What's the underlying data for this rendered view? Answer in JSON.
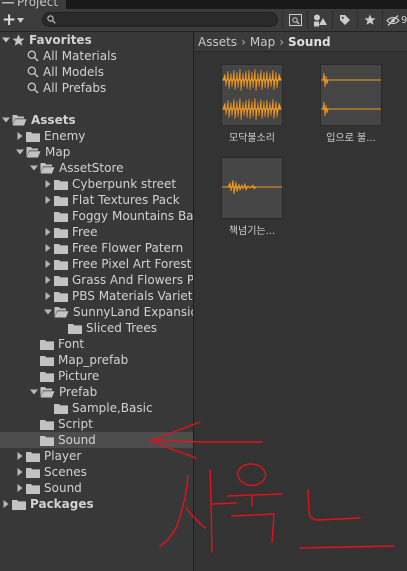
{
  "window": {
    "tab_title": "Project"
  },
  "toolbar": {
    "add_label": "+",
    "search_value": "",
    "hidden_count": "9"
  },
  "tree": {
    "favorites": {
      "label": "Favorites",
      "items": [
        {
          "label": "All Materials"
        },
        {
          "label": "All Models"
        },
        {
          "label": "All Prefabs"
        }
      ]
    },
    "rows": [
      {
        "label": "Assets",
        "bold": true,
        "expanded": true
      },
      {
        "label": "Enemy",
        "expanded": false
      },
      {
        "label": "Map",
        "expanded": true
      },
      {
        "label": "AssetStore",
        "expanded": true
      },
      {
        "label": "Cyberpunk street",
        "expanded": false
      },
      {
        "label": "Flat Textures Pack",
        "expanded": false
      },
      {
        "label": "Foggy Mountains Backgro"
      },
      {
        "label": "Free",
        "expanded": false
      },
      {
        "label": "Free Flower Patern",
        "expanded": false
      },
      {
        "label": "Free Pixel Art Forest",
        "expanded": false
      },
      {
        "label": "Grass And Flowers Pack",
        "expanded": false
      },
      {
        "label": "PBS Materials Variety",
        "expanded": false
      },
      {
        "label": "SunnyLand Expansion",
        "expanded": true
      },
      {
        "label": "Sliced Trees"
      },
      {
        "label": "Font"
      },
      {
        "label": "Map_prefab"
      },
      {
        "label": "Picture"
      },
      {
        "label": "Prefab",
        "expanded": true
      },
      {
        "label": "Sample,Basic"
      },
      {
        "label": "Script"
      },
      {
        "label": "Sound",
        "selected": true
      },
      {
        "label": "Player",
        "expanded": false
      },
      {
        "label": "Scenes",
        "expanded": false
      },
      {
        "label": "Sound",
        "expanded": false
      },
      {
        "label": "Packages",
        "bold": true,
        "expanded": false
      }
    ]
  },
  "breadcrumb": {
    "items": [
      "Assets",
      "Map",
      "Sound"
    ]
  },
  "assets": [
    {
      "label": "모닥불소리",
      "waveform": "dense"
    },
    {
      "label": "입으로 불...",
      "waveform": "sparse"
    },
    {
      "label": "책넘기는...",
      "waveform": "burst"
    }
  ],
  "colors": {
    "waveform": "#f39a1c",
    "selection": "#4d4d4d",
    "annotation": "#e0131a"
  },
  "annotation": {
    "text": "사운드"
  }
}
